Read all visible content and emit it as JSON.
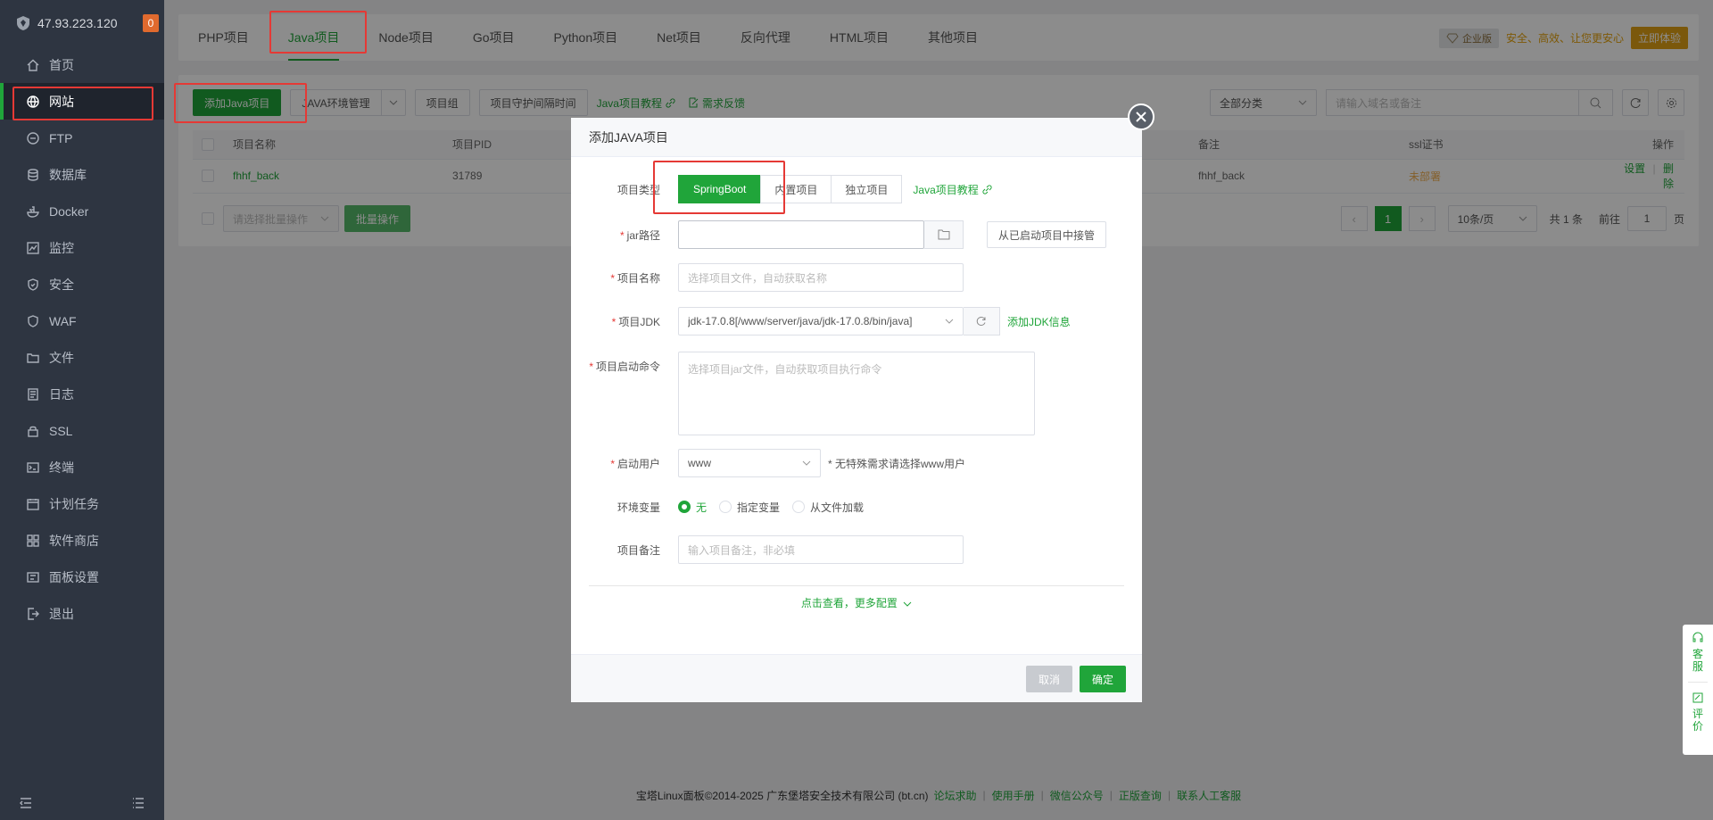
{
  "server": {
    "ip": "47.93.223.120",
    "badge": "0"
  },
  "sidebar": {
    "items": [
      {
        "label": "首页",
        "icon": "home-icon"
      },
      {
        "label": "网站",
        "icon": "globe-icon"
      },
      {
        "label": "FTP",
        "icon": "ftp-icon"
      },
      {
        "label": "数据库",
        "icon": "database-icon"
      },
      {
        "label": "Docker",
        "icon": "docker-icon"
      },
      {
        "label": "监控",
        "icon": "monitor-icon"
      },
      {
        "label": "安全",
        "icon": "shield-icon"
      },
      {
        "label": "WAF",
        "icon": "waf-icon"
      },
      {
        "label": "文件",
        "icon": "folder-icon"
      },
      {
        "label": "日志",
        "icon": "log-icon"
      },
      {
        "label": "SSL",
        "icon": "ssl-icon"
      },
      {
        "label": "终端",
        "icon": "terminal-icon"
      },
      {
        "label": "计划任务",
        "icon": "calendar-icon"
      },
      {
        "label": "软件商店",
        "icon": "store-icon"
      },
      {
        "label": "面板设置",
        "icon": "settings-icon"
      },
      {
        "label": "退出",
        "icon": "logout-icon"
      }
    ],
    "active_index": 1
  },
  "tabs": [
    "PHP项目",
    "Java项目",
    "Node项目",
    "Go项目",
    "Python项目",
    "Net项目",
    "反向代理",
    "HTML项目",
    "其他项目"
  ],
  "active_tab": "Java项目",
  "promo": {
    "edition": "企业版",
    "slogan": "安全、高效、让您更安心",
    "trial": "立即体验"
  },
  "toolbar": {
    "add": "添加Java项目",
    "env": "JAVA环境管理",
    "group": "项目组",
    "guard": "项目守护间隔时间",
    "tutorial": "Java项目教程",
    "feedback": "需求反馈",
    "category": "全部分类",
    "search_placeholder": "请输入域名或备注"
  },
  "table": {
    "headers": {
      "name": "项目名称",
      "pid": "项目PID",
      "remark": "备注",
      "ssl": "ssl证书",
      "ops": "操作"
    },
    "rows": [
      {
        "name": "fhhf_back",
        "pid": "31789",
        "remark": "fhhf_back",
        "ssl": "未部署",
        "setting": "设置",
        "delete": "删除"
      }
    ]
  },
  "bulk": {
    "select": "请选择批量操作",
    "btn": "批量操作"
  },
  "pagination": {
    "current": "1",
    "per_page": "10条/页",
    "total": "共 1 条",
    "goto_label": "前往",
    "goto_value": "1",
    "page_unit": "页"
  },
  "dialog": {
    "title": "添加JAVA项目",
    "type_label": "项目类型",
    "types": [
      "SpringBoot",
      "内置项目",
      "独立项目"
    ],
    "type_tutorial": "Java项目教程",
    "jar_label": "jar路径",
    "jar_value": "",
    "takeover": "从已启动项目中接管",
    "name_label": "项目名称",
    "name_placeholder": "选择项目文件，自动获取名称",
    "jdk_label": "项目JDK",
    "jdk_value": "jdk-17.0.8[/www/server/java/jdk-17.0.8/bin/java]",
    "add_jdk": "添加JDK信息",
    "cmd_label": "项目启动命令",
    "cmd_placeholder": "选择项目jar文件，自动获取项目执行命令",
    "user_label": "启动用户",
    "user_value": "www",
    "user_hint": "* 无特殊需求请选择www用户",
    "env_label": "环境变量",
    "env_options": [
      "无",
      "指定变量",
      "从文件加载"
    ],
    "remark_label": "项目备注",
    "remark_placeholder": "输入项目备注，非必填",
    "more": "点击查看，更多配置",
    "cancel": "取消",
    "confirm": "确定"
  },
  "footer": {
    "copyright": "宝塔Linux面板©2014-2025 广东堡塔安全技术有限公司 (bt.cn)",
    "links": [
      "论坛求助",
      "使用手册",
      "微信公众号",
      "正版查询",
      "联系人工客服"
    ]
  },
  "side_widget": {
    "service": "客服",
    "review": "评价"
  },
  "colors": {
    "primary": "#20a53a",
    "sidebar": "#2e3541",
    "highlight": "#e53935",
    "promo": "#e0a015"
  }
}
